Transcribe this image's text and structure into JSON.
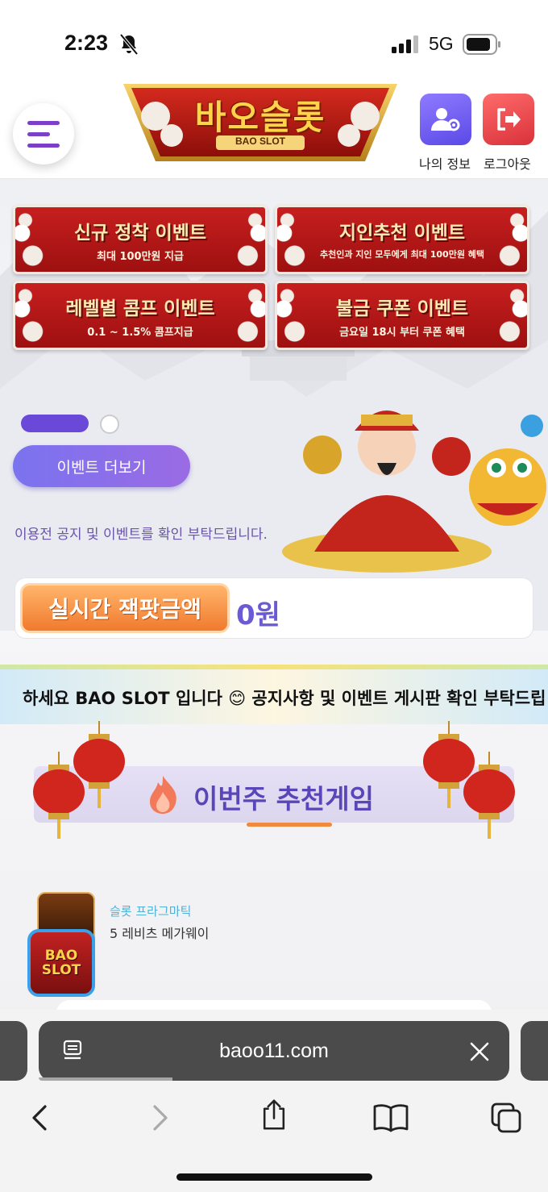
{
  "status_bar": {
    "time": "2:23",
    "network": "5G",
    "icons": [
      "bell-slash-icon",
      "signal-icon",
      "battery-icon"
    ]
  },
  "header": {
    "logo_text": "바오슬롯",
    "logo_sub": "BAO SLOT",
    "profile_label": "나의 정보",
    "logout_label": "로그아웃"
  },
  "events": [
    {
      "title": "신규 정착 이벤트",
      "subtitle": "최대 100만원 지급"
    },
    {
      "title": "지인추천 이벤트",
      "subtitle": "추천인과 지인 모두에게 최대 100만원 혜택"
    },
    {
      "title": "레벨별 콤프 이벤트",
      "subtitle": "0.1 ~ 1.5% 콤프지급"
    },
    {
      "title": "불금 쿠폰 이벤트",
      "subtitle": "금요일 18시 부터 쿠폰 혜택"
    }
  ],
  "hero": {
    "more_button": "이벤트 더보기",
    "notice": "이용전 공지 및 이벤트를 확인 부탁드립니다."
  },
  "jackpot": {
    "label": "실시간 잭팟금액",
    "value": "0원"
  },
  "ticker": {
    "text": "하세요 BAO SLOT 입니다 😊 공지사항 및 이벤트 게시판 확인 부탁드립"
  },
  "recommend": {
    "title": "이번주 추천게임"
  },
  "game": {
    "category": "슬롯 프라그마틱",
    "name": "5 레비츠 메가웨이"
  },
  "chat_float": {
    "line1": "BAO",
    "line2": "SLOT"
  },
  "browser": {
    "url": "baoo11.com"
  },
  "colors": {
    "accent_purple": "#6a48d8",
    "event_red": "#b51818",
    "jackpot_orange": "#f07a2e",
    "url_bar": "#4b4b4b"
  }
}
